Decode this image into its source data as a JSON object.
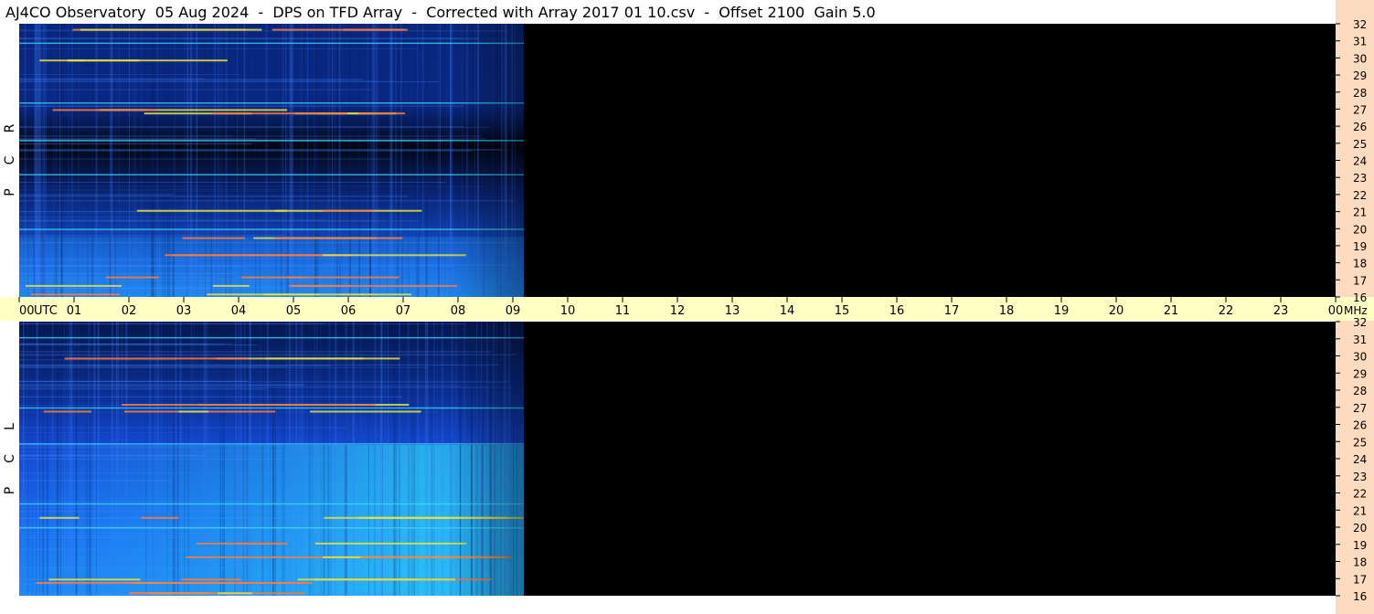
{
  "title": "AJ4CO Observatory  05 Aug 2024  -  DPS on TFD Array  -  Corrected with Array 2017 01 10.csv  -  Offset 2100  Gain 5.0",
  "colors": {
    "background": "#000000",
    "freq_axis_bg": "#fddbc0",
    "time_axis_bg": "#ffffc4",
    "signal_blue": "#1f6cff",
    "signal_cyan": "#22c6f0",
    "signal_hot": "#e8e040"
  },
  "chart_data": {
    "type": "heatmap",
    "x_unit": "UTC",
    "y_unit": "MHz",
    "x_ticks": [
      "00",
      "01",
      "02",
      "03",
      "04",
      "05",
      "06",
      "07",
      "08",
      "09",
      "10",
      "11",
      "12",
      "13",
      "14",
      "15",
      "16",
      "17",
      "18",
      "19",
      "20",
      "21",
      "22",
      "23",
      "00"
    ],
    "xlim": [
      0,
      24
    ],
    "ylim": [
      16,
      32
    ],
    "y_ticks": [
      16,
      17,
      18,
      19,
      20,
      21,
      22,
      23,
      24,
      25,
      26,
      27,
      28,
      29,
      30,
      31,
      32
    ],
    "data_end_hour": 9.2,
    "panels": [
      {
        "name": "RCP",
        "label_letters": [
          "R",
          "C",
          "P"
        ],
        "hot_lines_mhz": [
          16.2,
          16.7,
          17.2,
          18.5,
          19.5,
          21.1,
          26.8,
          27.0,
          29.9,
          31.7
        ],
        "cyan_lines_mhz": [
          20.0,
          23.2,
          25.2,
          27.4,
          30.9
        ]
      },
      {
        "name": "LCP",
        "label_letters": [
          "L",
          "C",
          "P"
        ],
        "hot_lines_mhz": [
          16.2,
          16.8,
          17.0,
          18.3,
          19.1,
          20.6,
          26.8,
          27.2,
          29.9
        ],
        "cyan_lines_mhz": [
          20.0,
          21.4,
          24.9,
          27.0,
          31.1
        ]
      }
    ]
  }
}
